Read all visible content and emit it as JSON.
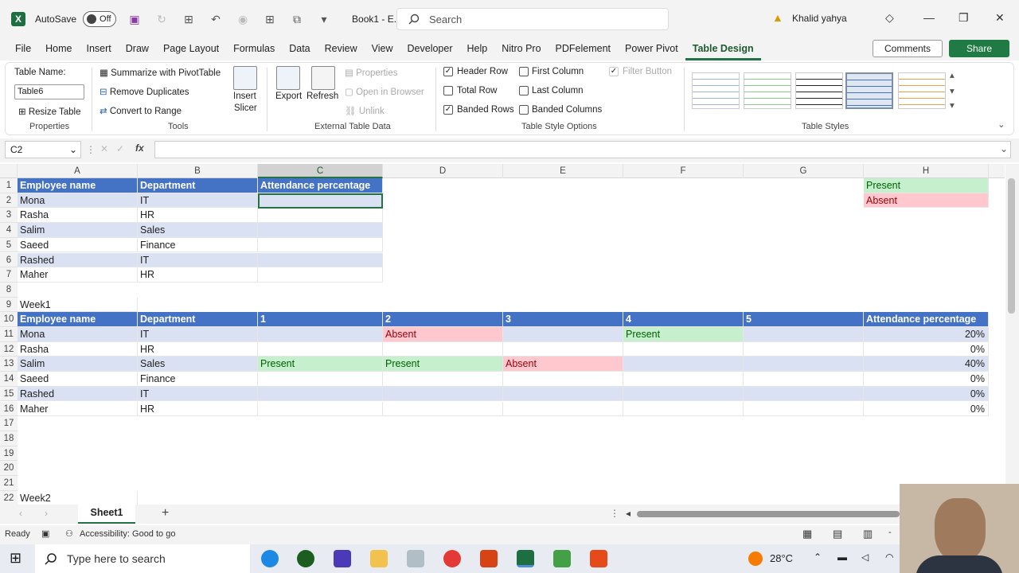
{
  "title_bar": {
    "autosave_label": "AutoSave",
    "autosave_state": "Off",
    "doc_title": "Book1 - E...",
    "search_placeholder": "Search",
    "user_name": "Khalid yahya"
  },
  "menu": [
    "File",
    "Home",
    "Insert",
    "Draw",
    "Page Layout",
    "Formulas",
    "Data",
    "Review",
    "View",
    "Developer",
    "Help",
    "Nitro Pro",
    "PDFelement",
    "Power Pivot",
    "Table Design"
  ],
  "menu_active": "Table Design",
  "comments_label": "Comments",
  "share_label": "Share",
  "ribbon": {
    "table_name_label": "Table Name:",
    "table_name_value": "Table6",
    "resize_table": "Resize Table",
    "properties_group": "Properties",
    "summarize": "Summarize with PivotTable",
    "remove_duplicates": "Remove Duplicates",
    "convert_to_range": "Convert to Range",
    "tools_group": "Tools",
    "insert_slicer": "Insert",
    "insert_slicer_2": "Slicer",
    "export": "Export",
    "refresh": "Refresh",
    "properties": "Properties",
    "open_in_browser": "Open in Browser",
    "unlink": "Unlink",
    "external_group": "External Table Data",
    "header_row": "Header Row",
    "total_row": "Total Row",
    "banded_rows": "Banded Rows",
    "first_column": "First Column",
    "last_column": "Last Column",
    "banded_columns": "Banded Columns",
    "filter_button": "Filter Button",
    "style_options_group": "Table Style Options",
    "table_styles_group": "Table Styles",
    "checked": {
      "header_row": true,
      "total_row": false,
      "banded_rows": true,
      "first_column": false,
      "last_column": false,
      "banded_columns": false,
      "filter_button": true
    }
  },
  "name_box": "C2",
  "fx_label": "fx",
  "columns": [
    "A",
    "B",
    "C",
    "D",
    "E",
    "F",
    "G",
    "H"
  ],
  "rows": [
    "1",
    "2",
    "3",
    "4",
    "5",
    "6",
    "7",
    "8",
    "9",
    "10",
    "11",
    "12",
    "13",
    "14",
    "15",
    "16",
    "17",
    "18",
    "19",
    "20",
    "21",
    "22"
  ],
  "table1": {
    "headers": [
      "Employee name",
      "Department",
      "Attendance percentage"
    ],
    "rows": [
      [
        "Mona",
        "IT",
        ""
      ],
      [
        "Rasha",
        "HR",
        ""
      ],
      [
        "Salim",
        "Sales",
        ""
      ],
      [
        "Saeed",
        "Finance",
        ""
      ],
      [
        "Rashed",
        "IT",
        ""
      ],
      [
        "Maher",
        "HR",
        ""
      ]
    ]
  },
  "legend": {
    "present": "Present",
    "absent": "Absent"
  },
  "week1_label": "Week1",
  "table2": {
    "headers": [
      "Employee name",
      "Department",
      "1",
      "2",
      "3",
      "4",
      "5",
      "Attendance percentage"
    ],
    "rows": [
      [
        "Mona",
        "IT",
        "",
        "Absent",
        "",
        "Present",
        "",
        "20%"
      ],
      [
        "Rasha",
        "HR",
        "",
        "",
        "",
        "",
        "",
        "0%"
      ],
      [
        "Salim",
        "Sales",
        "Present",
        "Present",
        "Absent",
        "",
        "",
        "40%"
      ],
      [
        "Saeed",
        "Finance",
        "",
        "",
        "",
        "",
        "",
        "0%"
      ],
      [
        "Rashed",
        "IT",
        "",
        "",
        "",
        "",
        "",
        "0%"
      ],
      [
        "Maher",
        "HR",
        "",
        "",
        "",
        "",
        "",
        "0%"
      ]
    ]
  },
  "week2_label": "Week2",
  "sheet_tab": "Sheet1",
  "status": {
    "ready": "Ready",
    "accessibility": "Accessibility: Good to go"
  },
  "taskbar": {
    "search_placeholder": "Type here to search",
    "temperature": "28°C"
  },
  "colors": {
    "header_blue": "#4472c4",
    "band": "#d9e1f2",
    "present_bg": "#c6efce",
    "absent_bg": "#ffc7ce",
    "excel_green": "#217346"
  }
}
